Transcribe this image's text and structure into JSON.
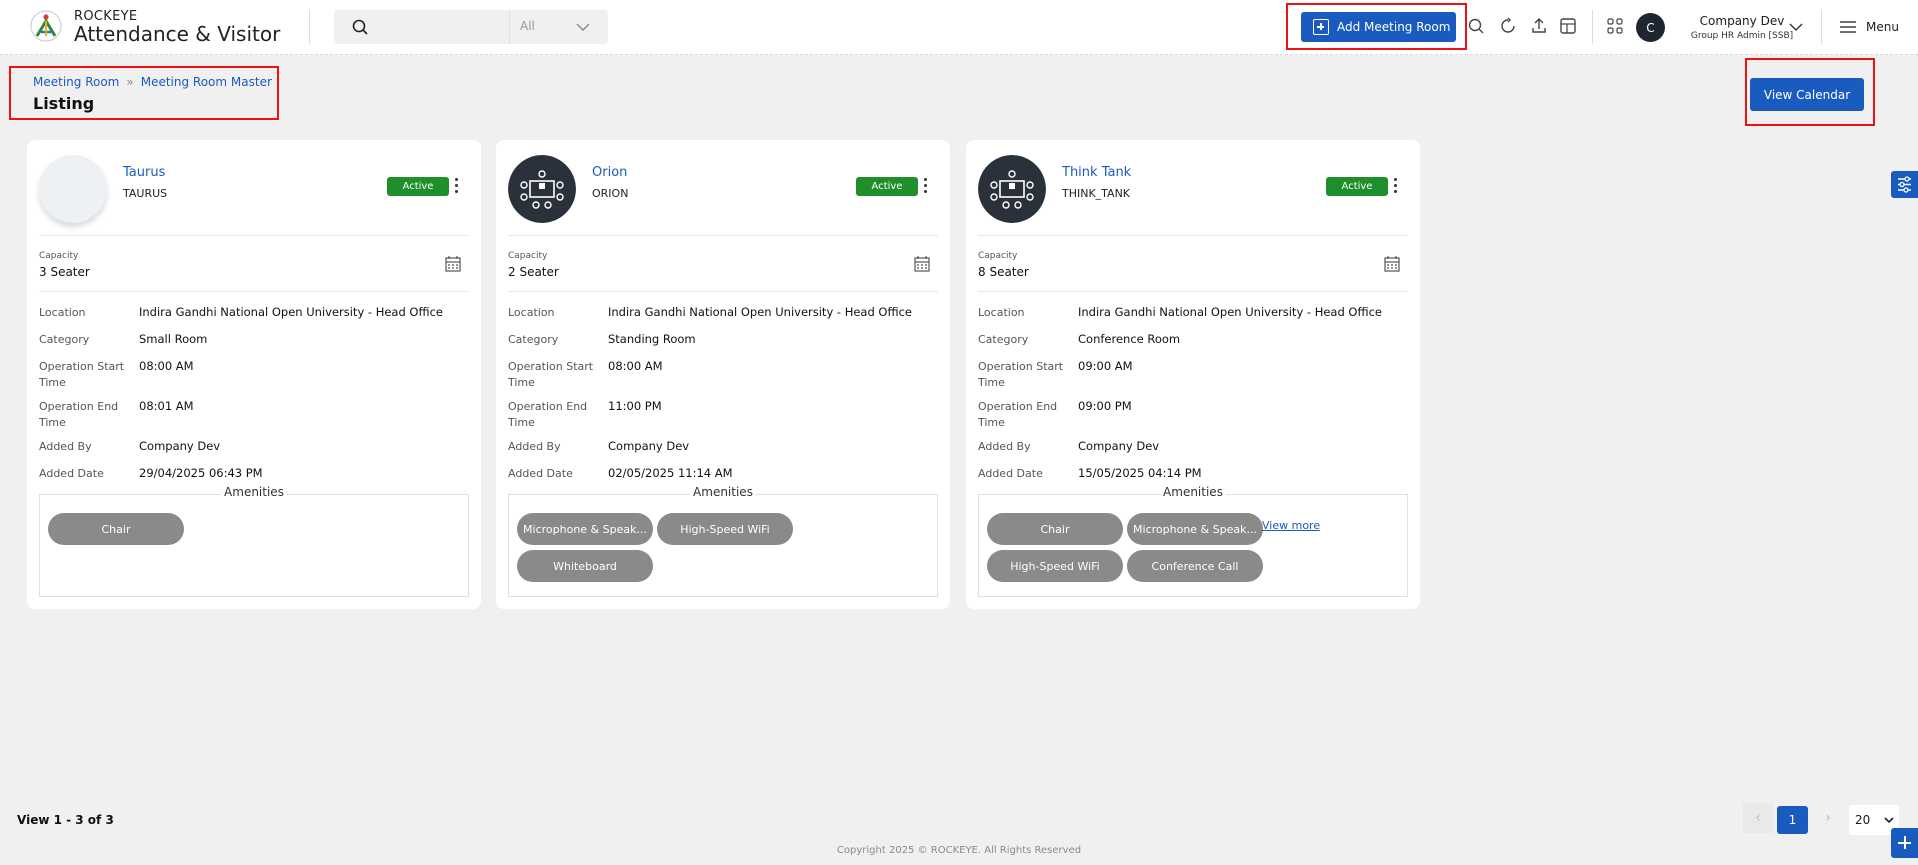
{
  "header": {
    "brand_top": "ROCKEYE",
    "brand_main": "Attendance & Visitor",
    "search_filter": "All",
    "add_button": "Add Meeting Room",
    "user_initial": "C",
    "user_name": "Company Dev",
    "user_role": "Group HR Admin [SSB]",
    "menu_label": "Menu"
  },
  "page": {
    "breadcrumb": [
      "Meeting Room",
      "Meeting Room Master"
    ],
    "title": "Listing",
    "view_calendar": "View Calendar"
  },
  "labels": {
    "capacity": "Capacity",
    "location": "Location",
    "category": "Category",
    "op_start": "Operation Start Time",
    "op_end": "Operation End Time",
    "added_by": "Added By",
    "added_date": "Added Date",
    "amenities": "Amenities",
    "view_more": "View more"
  },
  "rooms": [
    {
      "name": "Taurus",
      "code": "TAURUS",
      "status": "Active",
      "capacity": "3 Seater",
      "location": "Indira Gandhi National Open University - Head Office",
      "category": "Small Room",
      "op_start": "08:00 AM",
      "op_end": "08:01 AM",
      "added_by": "Company Dev",
      "added_date": "29/04/2025 06:43 PM",
      "amenities": [
        "Chair"
      ]
    },
    {
      "name": "Orion",
      "code": "ORION",
      "status": "Active",
      "capacity": "2 Seater",
      "location": "Indira Gandhi National Open University - Head Office",
      "category": "Standing Room",
      "op_start": "08:00 AM",
      "op_end": "11:00 PM",
      "added_by": "Company Dev",
      "added_date": "02/05/2025 11:14 AM",
      "amenities": [
        "Microphone & Speak...",
        "High-Speed WiFi",
        "Whiteboard"
      ]
    },
    {
      "name": "Think Tank",
      "code": "THINK_TANK",
      "status": "Active",
      "capacity": "8 Seater",
      "location": "Indira Gandhi National Open University - Head Office",
      "category": "Conference Room",
      "op_start": "09:00 AM",
      "op_end": "09:00 PM",
      "added_by": "Company Dev",
      "added_date": "15/05/2025 04:14 PM",
      "amenities": [
        "Chair",
        "Microphone & Speak...",
        "High-Speed WiFi",
        "Conference Call"
      ]
    }
  ],
  "footer": {
    "view_count": "View 1 - 3 of 3",
    "current_page": "1",
    "page_size": "20",
    "copyright": "Copyright 2025 © ROCKEYE. All Rights Reserved"
  },
  "colors": {
    "primary": "#1a5bbf",
    "active_badge": "#1f8f2b",
    "chip": "#8a8a8a",
    "highlight": "#ee1111"
  }
}
